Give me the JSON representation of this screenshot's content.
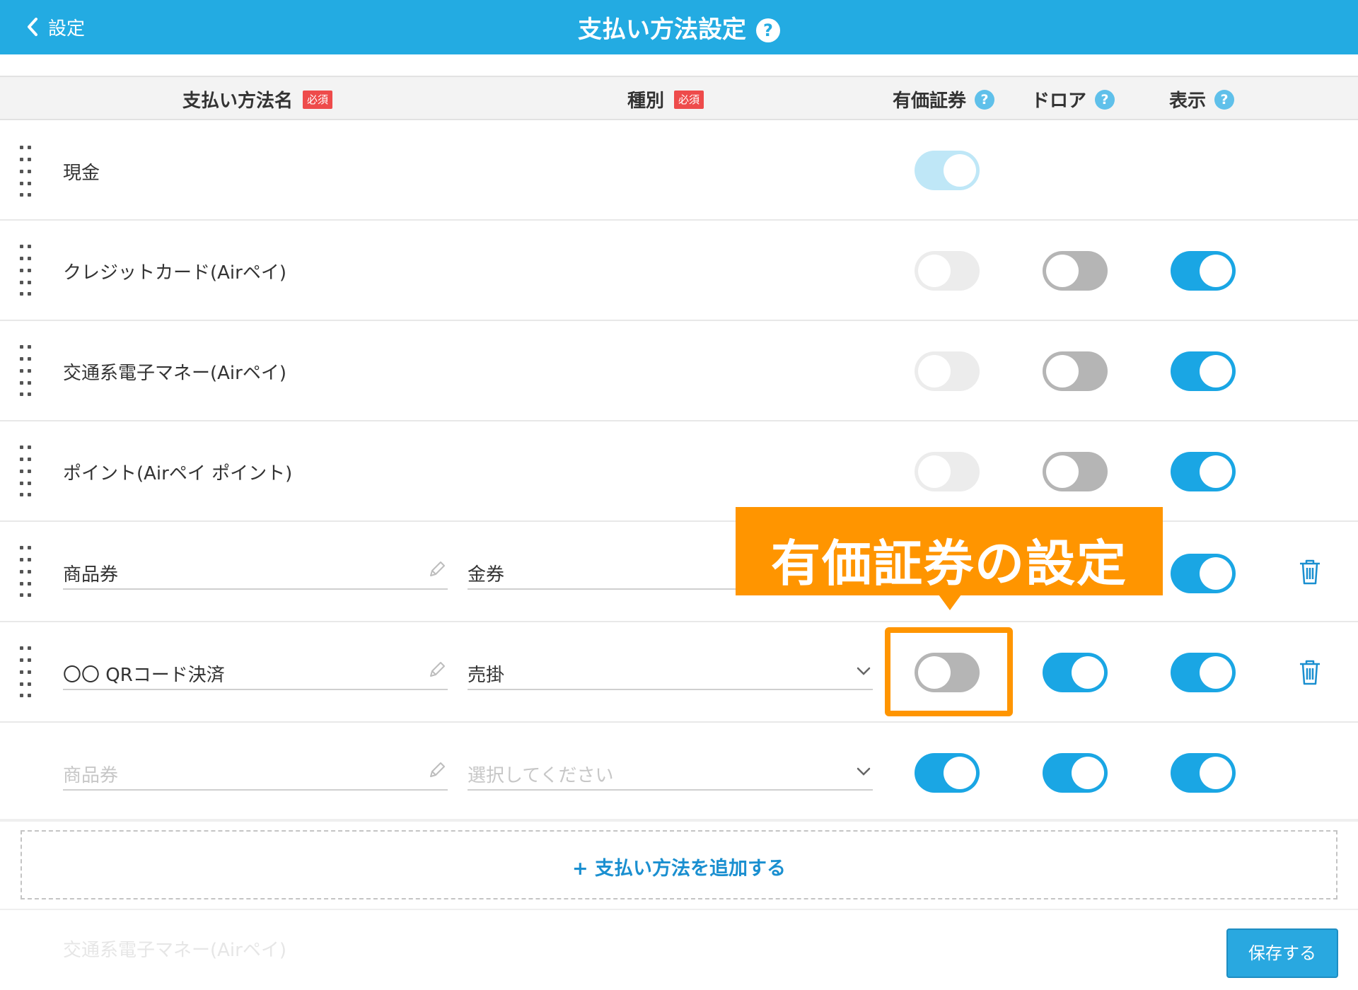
{
  "header": {
    "back_label": "設定",
    "title": "支払い方法設定",
    "help_glyph": "?"
  },
  "columns": {
    "name": {
      "label": "支払い方法名",
      "badge": "必須"
    },
    "type": {
      "label": "種別",
      "badge": "必須"
    },
    "securities": {
      "label": "有価証券",
      "help": "?"
    },
    "drawer": {
      "label": "ドロア",
      "help": "?"
    },
    "display": {
      "label": "表示",
      "help": "?"
    }
  },
  "rows": [
    {
      "name": "現金",
      "securities": "on-disabled",
      "drawer": null,
      "display": null
    },
    {
      "name": "クレジットカード(Airペイ)",
      "securities": "off-disabled",
      "drawer": "off",
      "display": "on"
    },
    {
      "name": "交通系電子マネー(Airペイ)",
      "securities": "off-disabled",
      "drawer": "off",
      "display": "on"
    },
    {
      "name": "ポイント(Airペイ ポイント)",
      "securities": "off-disabled",
      "drawer": "off",
      "display": "on"
    },
    {
      "name": "商品券",
      "type": "金券",
      "securities": "hidden",
      "drawer": "hidden",
      "display": "on",
      "deletable": true
    },
    {
      "name": "〇〇 QRコード決済",
      "type": "売掛",
      "securities": "off",
      "drawer": "on",
      "display": "on",
      "deletable": true
    },
    {
      "name_placeholder": "商品券",
      "type_placeholder": "選択してください",
      "securities": "on",
      "drawer": "on",
      "display": "on"
    }
  ],
  "callout": {
    "text": "有価証券の設定"
  },
  "add_button": {
    "label": "+ 支払い方法を追加する"
  },
  "footer": {
    "ghost_text": "交通系電子マネー(Airペイ)",
    "save_label": "保存する"
  },
  "colors": {
    "header_bg": "#23abe2",
    "toggle_on": "#1aa6e4",
    "toggle_off": "#b5b5b5",
    "required_badge": "#ee4b4b",
    "callout": "#ff9500",
    "link": "#1a8fd0"
  }
}
